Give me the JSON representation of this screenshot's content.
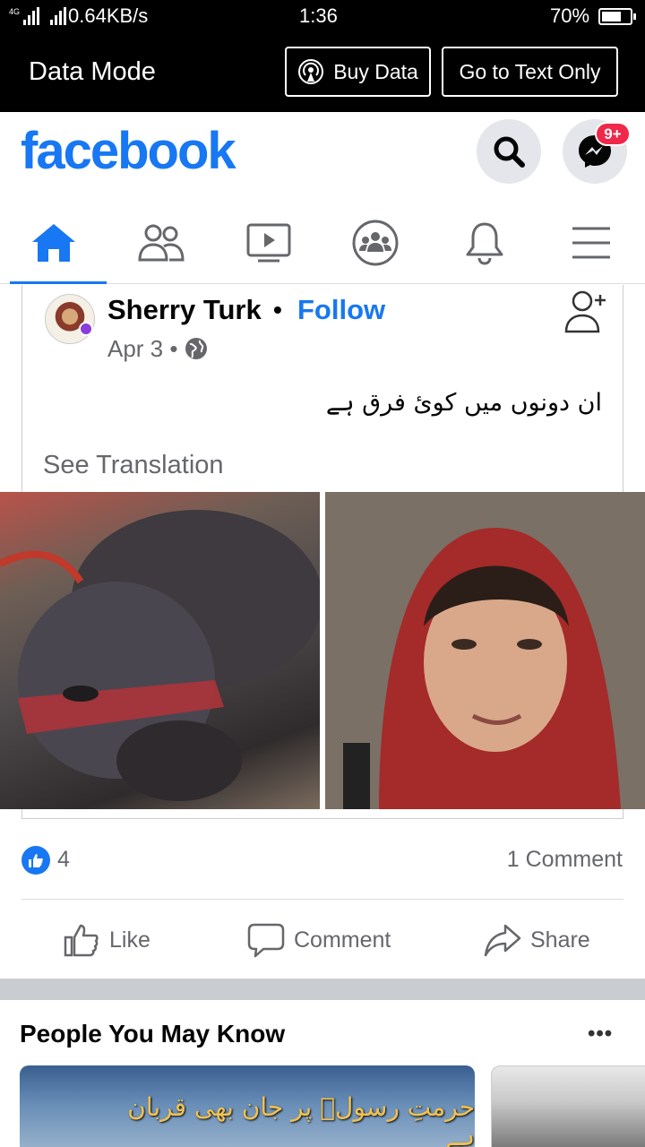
{
  "status_bar": {
    "network": "4G",
    "speed": "0.64KB/s",
    "time": "1:36",
    "battery": "70%",
    "battery_level": 0.7
  },
  "data_bar": {
    "title": "Data Mode",
    "buy_label": "Buy Data",
    "text_only_label": "Go to Text Only"
  },
  "header": {
    "logo": "facebook",
    "messenger_badge": "9+",
    "brand_color": "#1877f2"
  },
  "nav": {
    "tabs": [
      {
        "icon": "home-icon",
        "active": true
      },
      {
        "icon": "friends-icon",
        "active": false
      },
      {
        "icon": "watch-icon",
        "active": false
      },
      {
        "icon": "groups-icon",
        "active": false
      },
      {
        "icon": "bell-icon",
        "active": false
      },
      {
        "icon": "menu-icon",
        "active": false
      }
    ]
  },
  "post": {
    "author": "Sherry Turk",
    "separator": "•",
    "follow_label": "Follow",
    "date": "Apr 3 •",
    "text": "ان دونوں میں کوئ فرق ہے",
    "see_translation": "See Translation",
    "like_count": "4",
    "comment_count": "1 Comment",
    "actions": {
      "like": "Like",
      "comment": "Comment",
      "share": "Share"
    }
  },
  "pymk": {
    "title": "People You May Know",
    "more": "•••",
    "card1_banner": "حرمتِ رسولؐ پر جان بھی قربان ہے"
  }
}
